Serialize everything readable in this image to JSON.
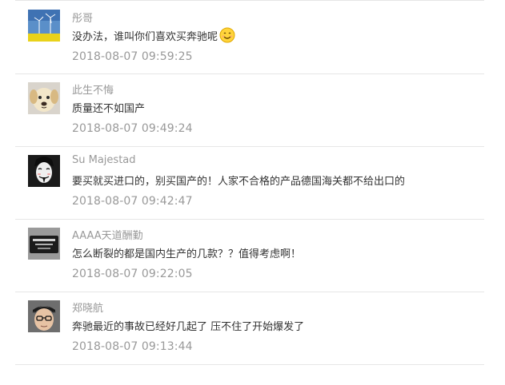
{
  "comments": [
    {
      "username": "彤哥",
      "content": "没办法，谁叫你们喜欢买奔驰呢",
      "emoji": "smile-emoji",
      "time": "2018-08-07 09:59:25",
      "avatar": "wind-turbine-avatar"
    },
    {
      "username": "此生不悔",
      "content": "质量还不如国产",
      "time": "2018-08-07 09:49:24",
      "avatar": "puppy-avatar"
    },
    {
      "username": "Su Majestad",
      "content": "要买就买进口的，别买国产的！人家不合格的产品德国海关都不给出口的",
      "time": "2018-08-07 09:42:47",
      "avatar": "mask-avatar"
    },
    {
      "username": "AAAA天道酬勤",
      "content": "怎么断裂的都是国内生产的几款？？值得考虑啊！",
      "time": "2018-08-07 09:22:05",
      "avatar": "sticker-avatar"
    },
    {
      "username": "郑晓航",
      "content": "奔驰最近的事故已经好几起了 压不住了开始爆发了",
      "time": "2018-08-07 09:13:44",
      "avatar": "person-glasses-avatar"
    }
  ]
}
